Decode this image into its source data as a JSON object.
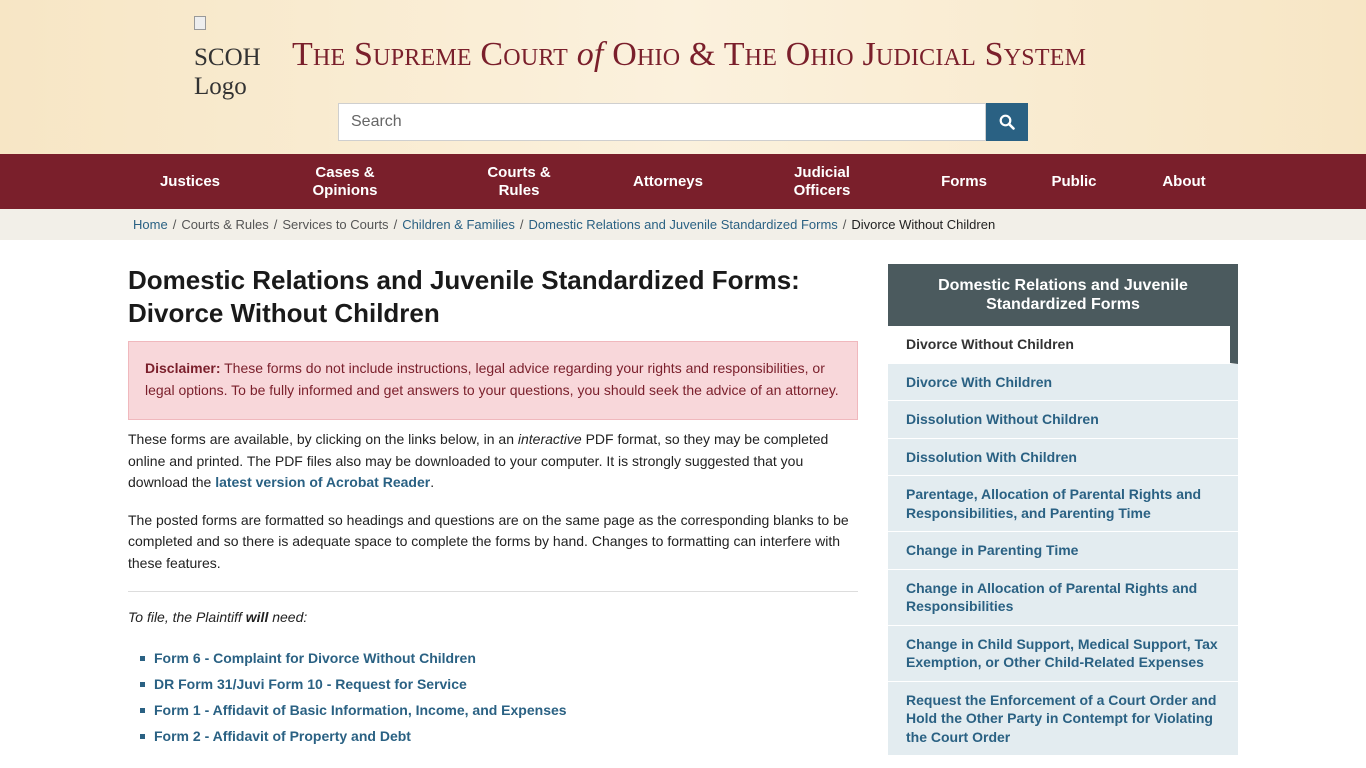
{
  "header": {
    "logo_alt": "SCOH Logo",
    "title_parts": [
      "The Supreme Court",
      "of",
      "Ohio & The Ohio Judicial System"
    ],
    "search_placeholder": "Search"
  },
  "nav": {
    "items": [
      {
        "label": "Justices"
      },
      {
        "label": "Cases & Opinions"
      },
      {
        "label": "Courts & Rules"
      },
      {
        "label": "Attorneys"
      },
      {
        "label": "Judicial Officers"
      },
      {
        "label": "Forms"
      },
      {
        "label": "Public"
      },
      {
        "label": "About"
      }
    ]
  },
  "breadcrumb": {
    "items": [
      "Home",
      "Courts & Rules",
      "Services to Courts",
      "Children & Families",
      "Domestic Relations and Juvenile Standardized Forms",
      "Divorce Without Children"
    ]
  },
  "main": {
    "title": "Domestic Relations and Juvenile Standardized Forms: Divorce Without Children",
    "disclaimer_label": "Disclaimer:",
    "disclaimer_text": " These forms do not include instructions, legal advice regarding your rights and responsibilities, or legal options. To be fully informed and get answers to your questions, you should seek the advice of an attorney.",
    "para1_a": "These forms are available, by clicking on the links below, in an ",
    "para1_em": "interactive",
    "para1_b": " PDF format, so they may be completed online and printed. The PDF files also may be downloaded to your computer. It is strongly suggested that you download the ",
    "para1_link": "latest version of Acrobat Reader",
    "para1_c": ".",
    "para2": "The posted forms are formatted so headings and questions are on the same page as the corresponding blanks to be completed and so there is adequate space to complete the forms by hand. Changes to formatting can interfere with these features.",
    "tofile_a": "To file, the Plaintiff ",
    "tofile_b": "will",
    "tofile_c": " need:",
    "forms": [
      "Form 6 - Complaint for Divorce Without Children",
      "DR Form 31/Juvi Form 10 - Request for Service",
      "Form 1 - Affidavit of Basic Information, Income, and Expenses",
      "Form 2 - Affidavit of Property and Debt"
    ]
  },
  "sidebar": {
    "heading": "Domestic Relations and Juvenile Standardized Forms",
    "items": [
      "Divorce Without Children",
      "Divorce With Children",
      "Dissolution Without Children",
      "Dissolution With Children",
      "Parentage, Allocation of Parental Rights and Responsibilities, and Parenting Time",
      "Change in Parenting Time",
      "Change in Allocation of Parental Rights and Responsibilities",
      "Change in Child Support, Medical Support, Tax Exemption, or Other Child-Related Expenses",
      "Request the Enforcement of a Court Order and Hold the Other Party in Contempt for Violating the Court Order"
    ]
  },
  "colors": {
    "brand_maroon": "#7a1f2b",
    "link_blue": "#2a6183",
    "sidebar_head": "#4b5a5e",
    "header_bg": "#f7e6c5"
  }
}
